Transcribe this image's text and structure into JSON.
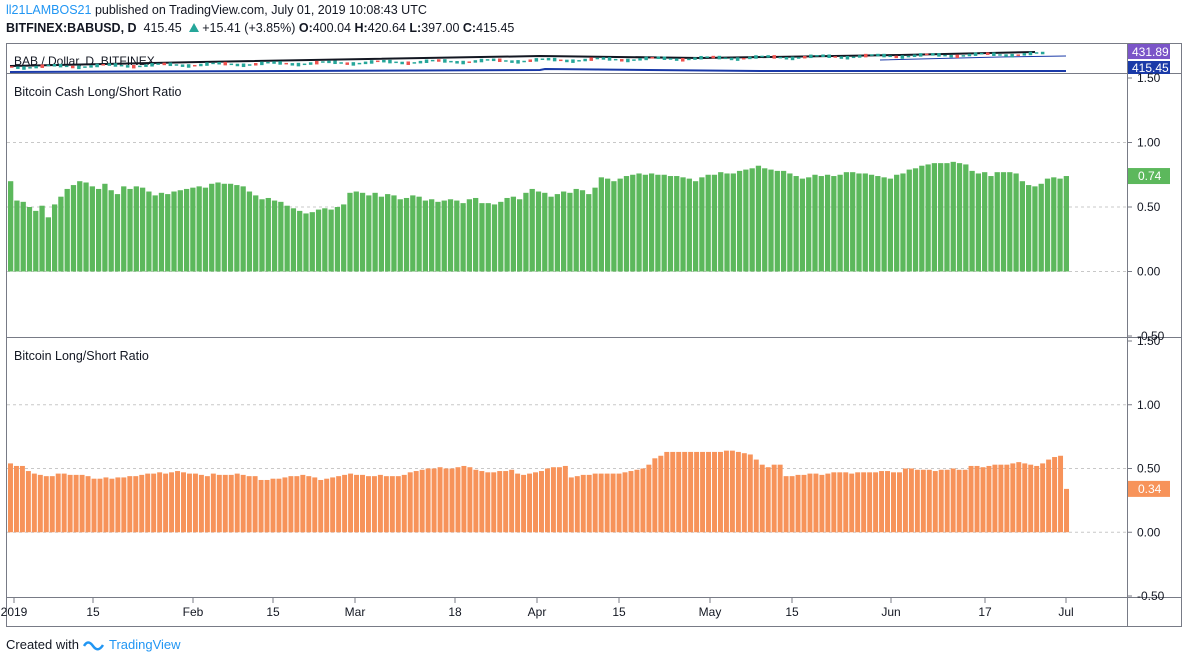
{
  "header": {
    "user": "ll21LAMBOS21",
    "published": " published on TradingView.com, July 01, 2019 10:08:43 UTC",
    "symbol": "BITFINEX:BABUSD, D",
    "last": "415.45",
    "change": "+15.41 (+3.85%)",
    "o_label": "O:",
    "o_value": "400.04",
    "h_label": "H:",
    "h_value": "420.64",
    "l_label": "L:",
    "l_value": "397.00",
    "c_label": "C:",
    "c_value": "415.45"
  },
  "footer": {
    "created": "Created with",
    "brand": "TradingView"
  },
  "colors": {
    "green": "#5cb85c",
    "orange": "#f7935a",
    "purple": "#7b55c8",
    "blue": "#1a3aa8",
    "bg": "#ffffff",
    "grid": "#c8c8c8",
    "axis": "#131722"
  },
  "chart_data": [
    {
      "type": "bar",
      "title": "BAB / Dollar, D, BITFINEX",
      "price_labels": [
        "431.89",
        "415.45"
      ],
      "price_label_colors": [
        "#7b55c8",
        "#1a3aa8"
      ]
    },
    {
      "type": "bar",
      "title": "Bitcoin Cash Long/Short Ratio",
      "current_label": "0.74",
      "color": "#5cb85c",
      "ylim": [
        -0.5,
        1.5
      ],
      "yticks": [
        "-0.50",
        "0.00",
        "0.50",
        "1.00",
        "1.50"
      ],
      "x_tick_labels": [
        "2019",
        "15",
        "Feb",
        "15",
        "Mar",
        "18",
        "Apr",
        "15",
        "May",
        "15",
        "Jun",
        "17",
        "Jul"
      ],
      "values": [
        0.7,
        0.55,
        0.54,
        0.5,
        0.47,
        0.51,
        0.42,
        0.52,
        0.58,
        0.64,
        0.67,
        0.7,
        0.69,
        0.66,
        0.64,
        0.68,
        0.63,
        0.6,
        0.66,
        0.64,
        0.66,
        0.65,
        0.62,
        0.59,
        0.61,
        0.6,
        0.62,
        0.63,
        0.64,
        0.65,
        0.66,
        0.65,
        0.68,
        0.69,
        0.68,
        0.68,
        0.67,
        0.66,
        0.62,
        0.59,
        0.56,
        0.57,
        0.55,
        0.54,
        0.51,
        0.49,
        0.47,
        0.45,
        0.46,
        0.48,
        0.49,
        0.48,
        0.5,
        0.52,
        0.61,
        0.62,
        0.61,
        0.59,
        0.61,
        0.58,
        0.6,
        0.59,
        0.56,
        0.57,
        0.59,
        0.58,
        0.55,
        0.56,
        0.54,
        0.55,
        0.56,
        0.55,
        0.53,
        0.56,
        0.57,
        0.53,
        0.53,
        0.52,
        0.54,
        0.57,
        0.58,
        0.56,
        0.61,
        0.64,
        0.62,
        0.61,
        0.58,
        0.6,
        0.62,
        0.61,
        0.64,
        0.63,
        0.6,
        0.65,
        0.73,
        0.72,
        0.7,
        0.72,
        0.74,
        0.75,
        0.76,
        0.75,
        0.76,
        0.75,
        0.75,
        0.74,
        0.74,
        0.73,
        0.72,
        0.7,
        0.73,
        0.75,
        0.75,
        0.77,
        0.76,
        0.76,
        0.78,
        0.79,
        0.8,
        0.82,
        0.8,
        0.79,
        0.78,
        0.78,
        0.76,
        0.74,
        0.72,
        0.73,
        0.75,
        0.74,
        0.75,
        0.74,
        0.75,
        0.77,
        0.77,
        0.76,
        0.76,
        0.75,
        0.74,
        0.73,
        0.72,
        0.75,
        0.76,
        0.79,
        0.8,
        0.82,
        0.83,
        0.84,
        0.84,
        0.84,
        0.85,
        0.84,
        0.83,
        0.78,
        0.76,
        0.77,
        0.74,
        0.77,
        0.77,
        0.77,
        0.76,
        0.7,
        0.67,
        0.66,
        0.68,
        0.72,
        0.73,
        0.72,
        0.74
      ]
    },
    {
      "type": "bar",
      "title": "Bitcoin Long/Short Ratio",
      "current_label": "0.34",
      "color": "#f7935a",
      "ylim": [
        -0.5,
        1.5
      ],
      "yticks": [
        "-0.50",
        "0.00",
        "0.50",
        "1.00",
        "1.50"
      ],
      "x_tick_labels": [
        "2019",
        "15",
        "Feb",
        "15",
        "Mar",
        "18",
        "Apr",
        "15",
        "May",
        "15",
        "Jun",
        "17",
        "Jul"
      ],
      "values": [
        0.54,
        0.52,
        0.52,
        0.48,
        0.46,
        0.45,
        0.44,
        0.44,
        0.46,
        0.46,
        0.45,
        0.45,
        0.45,
        0.44,
        0.42,
        0.42,
        0.43,
        0.42,
        0.43,
        0.43,
        0.44,
        0.44,
        0.45,
        0.46,
        0.46,
        0.47,
        0.46,
        0.47,
        0.48,
        0.47,
        0.46,
        0.46,
        0.45,
        0.44,
        0.46,
        0.45,
        0.45,
        0.45,
        0.46,
        0.45,
        0.44,
        0.44,
        0.41,
        0.41,
        0.42,
        0.42,
        0.43,
        0.44,
        0.44,
        0.45,
        0.44,
        0.43,
        0.41,
        0.42,
        0.43,
        0.44,
        0.45,
        0.46,
        0.45,
        0.45,
        0.44,
        0.44,
        0.45,
        0.44,
        0.44,
        0.44,
        0.45,
        0.47,
        0.48,
        0.49,
        0.5,
        0.5,
        0.51,
        0.5,
        0.5,
        0.51,
        0.52,
        0.51,
        0.49,
        0.48,
        0.47,
        0.47,
        0.48,
        0.48,
        0.49,
        0.46,
        0.45,
        0.46,
        0.47,
        0.48,
        0.5,
        0.51,
        0.51,
        0.52,
        0.43,
        0.44,
        0.45,
        0.45,
        0.46,
        0.46,
        0.46,
        0.46,
        0.46,
        0.47,
        0.48,
        0.49,
        0.5,
        0.53,
        0.58,
        0.6,
        0.63,
        0.63,
        0.63,
        0.63,
        0.63,
        0.63,
        0.63,
        0.63,
        0.63,
        0.63,
        0.64,
        0.64,
        0.63,
        0.62,
        0.61,
        0.57,
        0.53,
        0.51,
        0.53,
        0.53,
        0.44,
        0.44,
        0.45,
        0.45,
        0.46,
        0.46,
        0.45,
        0.46,
        0.47,
        0.47,
        0.47,
        0.46,
        0.47,
        0.47,
        0.47,
        0.47,
        0.48,
        0.48,
        0.47,
        0.47,
        0.5,
        0.5,
        0.49,
        0.49,
        0.49,
        0.48,
        0.49,
        0.49,
        0.5,
        0.49,
        0.49,
        0.52,
        0.52,
        0.51,
        0.52,
        0.53,
        0.53,
        0.53,
        0.54,
        0.55,
        0.54,
        0.53,
        0.52,
        0.54,
        0.57,
        0.59,
        0.6,
        0.34
      ]
    }
  ]
}
